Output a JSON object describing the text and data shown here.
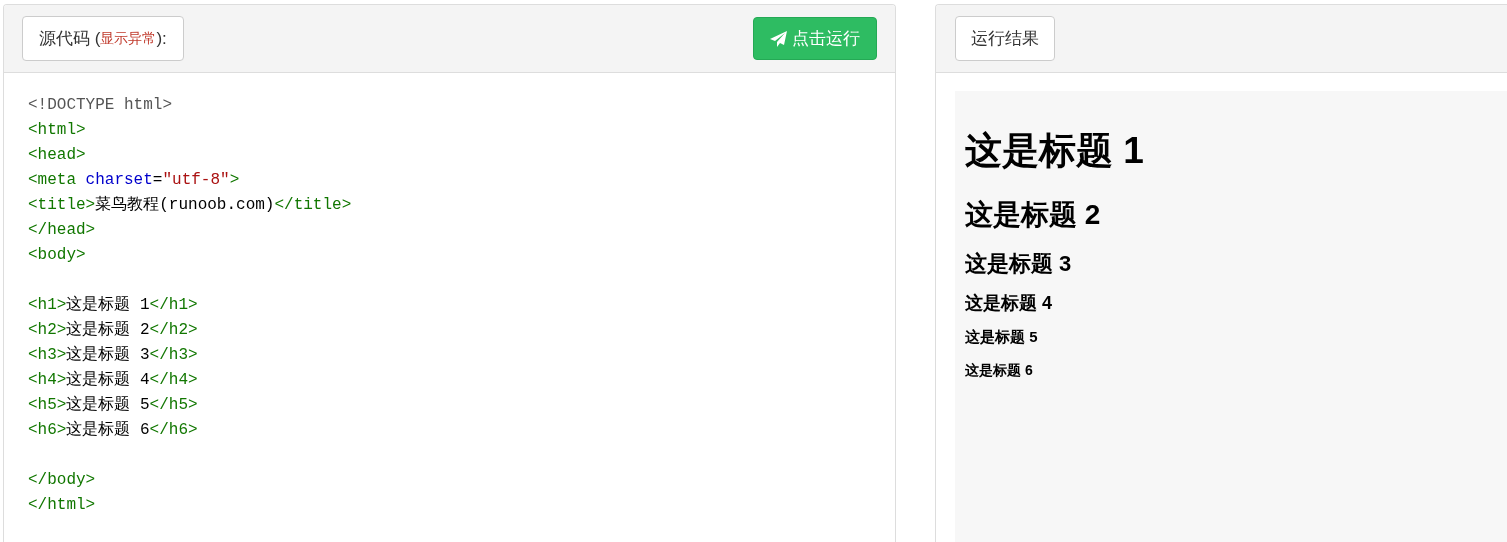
{
  "source_panel": {
    "title_prefix": "源代码 (",
    "title_note": "显示异常",
    "title_suffix": "):",
    "run_button": "点击运行",
    "code_lines": [
      {
        "kind": "code",
        "tokens": [
          {
            "kind": "doctype",
            "text": "<!DOCTYPE html>"
          }
        ]
      },
      {
        "kind": "code",
        "tokens": [
          {
            "kind": "tag",
            "text": "<html>"
          }
        ]
      },
      {
        "kind": "code",
        "tokens": [
          {
            "kind": "tag",
            "text": "<head>"
          }
        ]
      },
      {
        "kind": "code",
        "tokens": [
          {
            "kind": "tag",
            "text": "<meta "
          },
          {
            "kind": "attr",
            "text": "charset"
          },
          {
            "kind": "text",
            "text": "="
          },
          {
            "kind": "string",
            "text": "\"utf-8\""
          },
          {
            "kind": "tag",
            "text": ">"
          }
        ]
      },
      {
        "kind": "code",
        "tokens": [
          {
            "kind": "tag",
            "text": "<title>"
          },
          {
            "kind": "text",
            "text": "菜鸟教程(runoob.com)"
          },
          {
            "kind": "tag",
            "text": "</title>"
          }
        ]
      },
      {
        "kind": "code",
        "tokens": [
          {
            "kind": "tag",
            "text": "</head>"
          }
        ]
      },
      {
        "kind": "code",
        "tokens": [
          {
            "kind": "tag",
            "text": "<body>"
          }
        ]
      },
      {
        "kind": "blank"
      },
      {
        "kind": "code",
        "tokens": [
          {
            "kind": "tag",
            "text": "<h1>"
          },
          {
            "kind": "text",
            "text": "这是标题 1"
          },
          {
            "kind": "tag",
            "text": "</h1>"
          }
        ]
      },
      {
        "kind": "code",
        "tokens": [
          {
            "kind": "tag",
            "text": "<h2>"
          },
          {
            "kind": "text",
            "text": "这是标题 2"
          },
          {
            "kind": "tag",
            "text": "</h2>"
          }
        ]
      },
      {
        "kind": "code",
        "tokens": [
          {
            "kind": "tag",
            "text": "<h3>"
          },
          {
            "kind": "text",
            "text": "这是标题 3"
          },
          {
            "kind": "tag",
            "text": "</h3>"
          }
        ]
      },
      {
        "kind": "code",
        "tokens": [
          {
            "kind": "tag",
            "text": "<h4>"
          },
          {
            "kind": "text",
            "text": "这是标题 4"
          },
          {
            "kind": "tag",
            "text": "</h4>"
          }
        ]
      },
      {
        "kind": "code",
        "tokens": [
          {
            "kind": "tag",
            "text": "<h5>"
          },
          {
            "kind": "text",
            "text": "这是标题 5"
          },
          {
            "kind": "tag",
            "text": "</h5>"
          }
        ]
      },
      {
        "kind": "code",
        "tokens": [
          {
            "kind": "tag",
            "text": "<h6>"
          },
          {
            "kind": "text",
            "text": "这是标题 6"
          },
          {
            "kind": "tag",
            "text": "</h6>"
          }
        ]
      },
      {
        "kind": "blank"
      },
      {
        "kind": "code",
        "tokens": [
          {
            "kind": "tag",
            "text": "</body>"
          }
        ]
      },
      {
        "kind": "code",
        "tokens": [
          {
            "kind": "tag",
            "text": "</html>"
          }
        ]
      }
    ]
  },
  "result_panel": {
    "title": "运行结果",
    "headings": [
      {
        "kind": "h1",
        "text": "这是标题 1"
      },
      {
        "kind": "h2",
        "text": "这是标题 2"
      },
      {
        "kind": "h3",
        "text": "这是标题 3"
      },
      {
        "kind": "h4",
        "text": "这是标题 4"
      },
      {
        "kind": "h5",
        "text": "这是标题 5"
      },
      {
        "kind": "h6",
        "text": "这是标题 6"
      }
    ]
  }
}
